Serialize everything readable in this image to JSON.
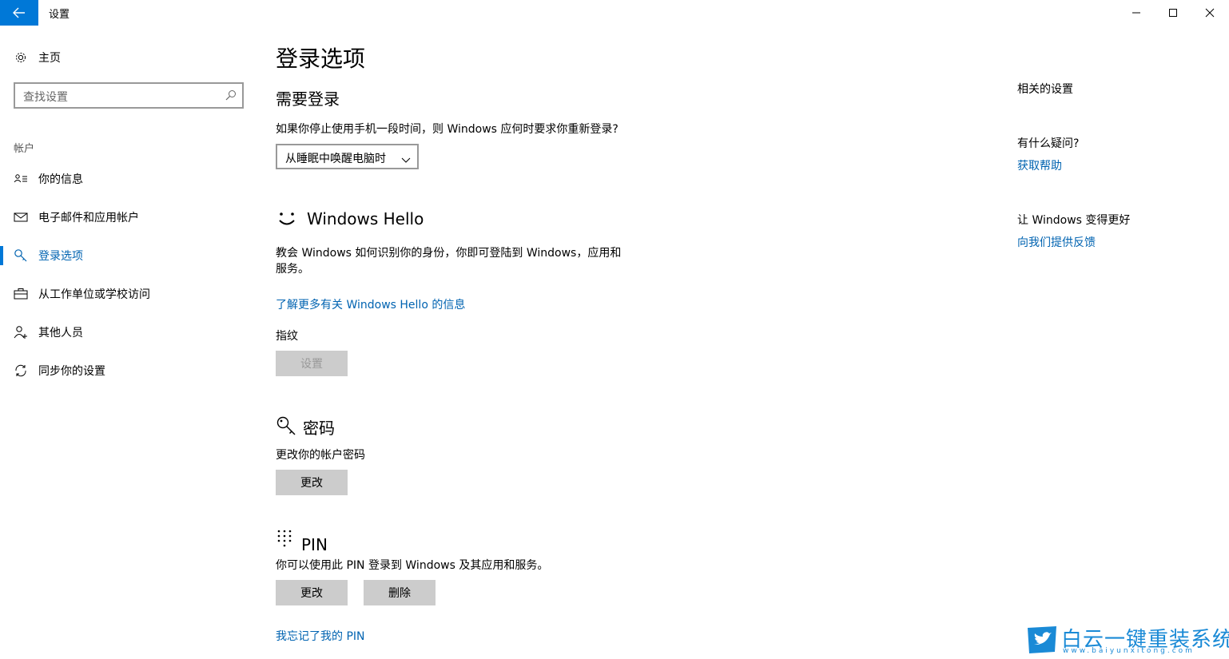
{
  "window": {
    "title": "设置",
    "back_icon": "arrow-left-icon",
    "accent_color": "#0078d7"
  },
  "sidebar": {
    "home_label": "主页",
    "search_placeholder": "查找设置",
    "group_label": "帐户",
    "items": [
      {
        "label": "你的信息",
        "icon": "person-card-icon"
      },
      {
        "label": "电子邮件和应用帐户",
        "icon": "mail-icon"
      },
      {
        "label": "登录选项",
        "icon": "key-icon",
        "active": true
      },
      {
        "label": "从工作单位或学校访问",
        "icon": "briefcase-icon"
      },
      {
        "label": "其他人员",
        "icon": "person-add-icon"
      },
      {
        "label": "同步你的设置",
        "icon": "sync-icon"
      }
    ]
  },
  "main": {
    "page_title": "登录选项",
    "require_signin": {
      "heading": "需要登录",
      "question": "如果你停止使用手机一段时间，则 Windows 应何时要求你重新登录?",
      "dropdown_value": "从睡眠中唤醒电脑时"
    },
    "hello": {
      "heading": "Windows Hello",
      "description": "教会 Windows 如何识别你的身份，你即可登陆到 Windows，应用和服务。",
      "link": "了解更多有关 Windows Hello 的信息",
      "fingerprint_label": "指纹",
      "setup_button": "设置"
    },
    "password": {
      "heading": "密码",
      "description": "更改你的帐户密码",
      "change_button": "更改"
    },
    "pin": {
      "heading": "PIN",
      "description": "你可以使用此 PIN 登录到 Windows 及其应用和服务。",
      "change_button": "更改",
      "remove_button": "删除",
      "forgot_link": "我忘记了我的 PIN"
    }
  },
  "right": {
    "related_heading": "相关的设置",
    "question_heading": "有什么疑问?",
    "help_link": "获取帮助",
    "improve_heading": "让 Windows 变得更好",
    "feedback_link": "向我们提供反馈"
  },
  "watermark": {
    "title": "白云一键重装系统",
    "subtitle": "www.baiyunxitong.com"
  }
}
